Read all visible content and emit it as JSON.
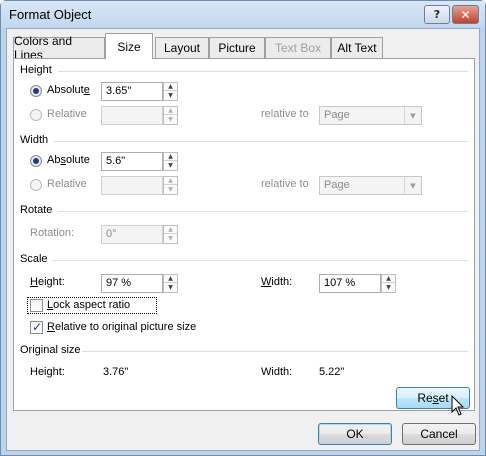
{
  "window": {
    "title": "Format Object",
    "help_glyph": "?",
    "close_glyph": "✕"
  },
  "tabs": [
    {
      "label": "Colors and Lines",
      "state": "normal"
    },
    {
      "label": "Size",
      "state": "active"
    },
    {
      "label": "Layout",
      "state": "normal"
    },
    {
      "label": "Picture",
      "state": "normal"
    },
    {
      "label": "Text Box",
      "state": "disabled"
    },
    {
      "label": "Alt Text",
      "state": "normal"
    }
  ],
  "height_section": {
    "title": "Height",
    "absolute_label_pre": "Absolut",
    "absolute_label_u": "e",
    "absolute_value": "3.65\"",
    "relative_label": "Relative",
    "relative_value": "",
    "relative_to_label": "relative to",
    "relative_to_value": "Page"
  },
  "width_section": {
    "title": "Width",
    "absolute_label_pre": "Ab",
    "absolute_label_u": "s",
    "absolute_label_post": "olute",
    "absolute_value": "5.6\"",
    "relative_label": "Relative",
    "relative_value": "",
    "relative_to_label": "relative to",
    "relative_to_value": "Page"
  },
  "rotate_section": {
    "title": "Rotate",
    "rotation_label": "Rotation:",
    "rotation_value": "0°"
  },
  "scale_section": {
    "title": "Scale",
    "height_label_u": "H",
    "height_label_post": "eight:",
    "height_value": "97 %",
    "width_label_u": "W",
    "width_label_post": "idth:",
    "width_value": "107 %",
    "lock_aspect_u": "L",
    "lock_aspect_post": "ock aspect ratio",
    "lock_aspect_checked": false,
    "relative_original_u": "R",
    "relative_original_post": "elative to original picture size",
    "relative_original_checked": true
  },
  "original_size_section": {
    "title": "Original size",
    "height_label": "Height:",
    "height_value": "3.76\"",
    "width_label": "Width:",
    "width_value": "5.22\""
  },
  "buttons": {
    "reset_pre": "Re",
    "reset_u": "s",
    "reset_post": "et",
    "ok": "OK",
    "cancel": "Cancel"
  },
  "colors": {
    "window_frame": "#bcd3ea",
    "close_button": "#c4412b",
    "radio_dot": "#1c3d8c",
    "hover_button": "#bee6fd"
  }
}
